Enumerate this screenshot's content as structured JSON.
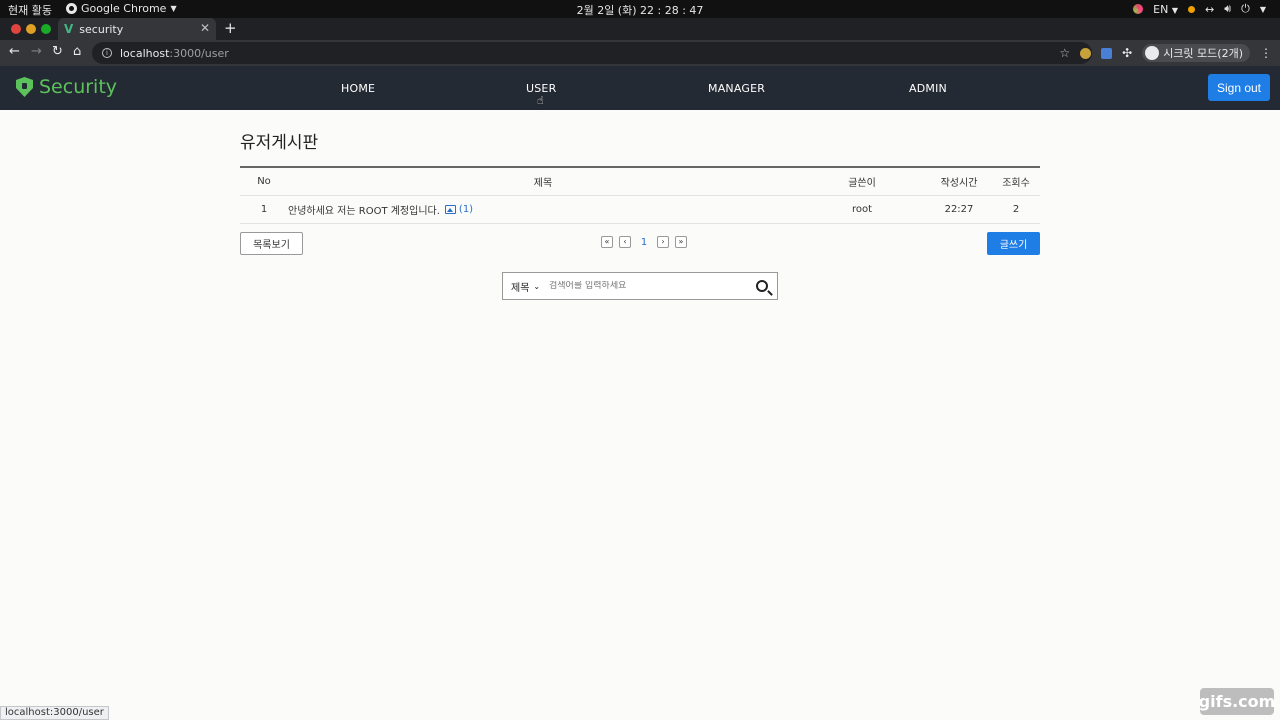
{
  "os": {
    "activities": "현재 활동",
    "app_name": "Google Chrome",
    "clock": "2월 2일 (화)  22 : 28 : 47",
    "lang": "EN"
  },
  "browser": {
    "tab_title": "security",
    "url_host": "localhost",
    "url_path": ":3000/user",
    "incognito_label": "시크릿 모드(2개)",
    "status_url": "localhost:3000/user"
  },
  "navbar": {
    "brand": "Security",
    "links": [
      "HOME",
      "USER",
      "MANAGER",
      "ADMIN"
    ],
    "signout_label": "Sign out"
  },
  "page": {
    "title": "유저게시판",
    "table": {
      "headers": {
        "no": "No",
        "title": "제목",
        "writer": "글쓴이",
        "time": "작성시간",
        "views": "조회수"
      },
      "rows": [
        {
          "no": "1",
          "title": "안녕하세요 저는 ROOT 계정입니다.",
          "comments": "(1)",
          "writer": "root",
          "time": "22:27",
          "views": "2"
        }
      ]
    },
    "list_button": "목록보기",
    "write_button": "글쓰기",
    "pagination": {
      "current": "1",
      "first": "«",
      "prev": "‹",
      "next": "›",
      "last": "»"
    },
    "search": {
      "select_value": "제목",
      "placeholder": "검색어를 입력하세요"
    }
  },
  "watermark": "gifs.com",
  "colors": {
    "navbar_bg": "#242a33",
    "brand_green": "#5cc35c",
    "primary_blue": "#1f7de6",
    "link_blue": "#2a6fc9"
  }
}
